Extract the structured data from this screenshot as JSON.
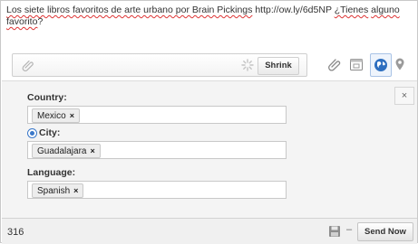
{
  "message": {
    "part1": "Los siete libros favoritos de arte urbano por Brain Pickings",
    "part2": "http://ow.ly/6d5NP",
    "part3": "¿Tienes",
    "part4": "alguno favorito",
    "part5": "?"
  },
  "toolbar": {
    "shrink_label": "Shrink"
  },
  "targeting": {
    "country_label": "Country:",
    "country_value": "Mexico",
    "city_label": "City:",
    "city_value": "Guadalajara",
    "language_label": "Language:",
    "language_value": "Spanish",
    "close_label": "×",
    "remove_label": "×"
  },
  "footer": {
    "char_count": "316",
    "separator": "–",
    "send_label": "Send Now"
  },
  "colors": {
    "accent": "#3a78c9",
    "globe": "#2e6fc0"
  }
}
